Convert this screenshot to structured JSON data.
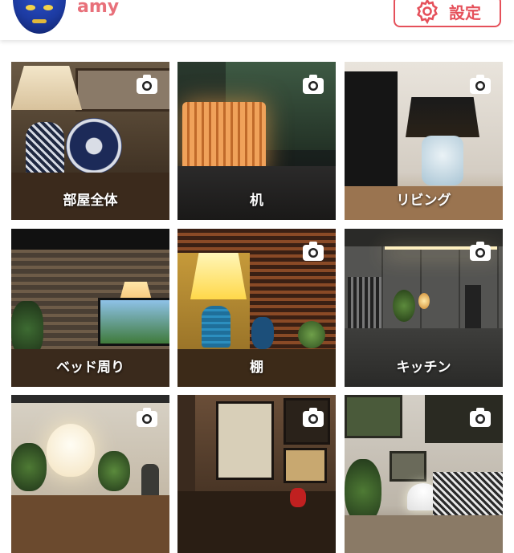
{
  "header": {
    "username": "amy",
    "settings_label": "設定",
    "avatar_icon": "sun-face-icon",
    "accent": "#e5505a"
  },
  "rooms": [
    {
      "label": "部屋全体",
      "icon": "camera-icon"
    },
    {
      "label": "机",
      "icon": "camera-icon"
    },
    {
      "label": "リビング",
      "icon": "camera-icon"
    },
    {
      "label": "ベッド周り",
      "icon": "camera-icon"
    },
    {
      "label": "棚",
      "icon": "camera-icon"
    },
    {
      "label": "キッチン",
      "icon": "camera-icon"
    },
    {
      "label": "",
      "icon": "camera-icon"
    },
    {
      "label": "",
      "icon": "camera-icon"
    },
    {
      "label": "",
      "icon": "camera-icon"
    }
  ]
}
